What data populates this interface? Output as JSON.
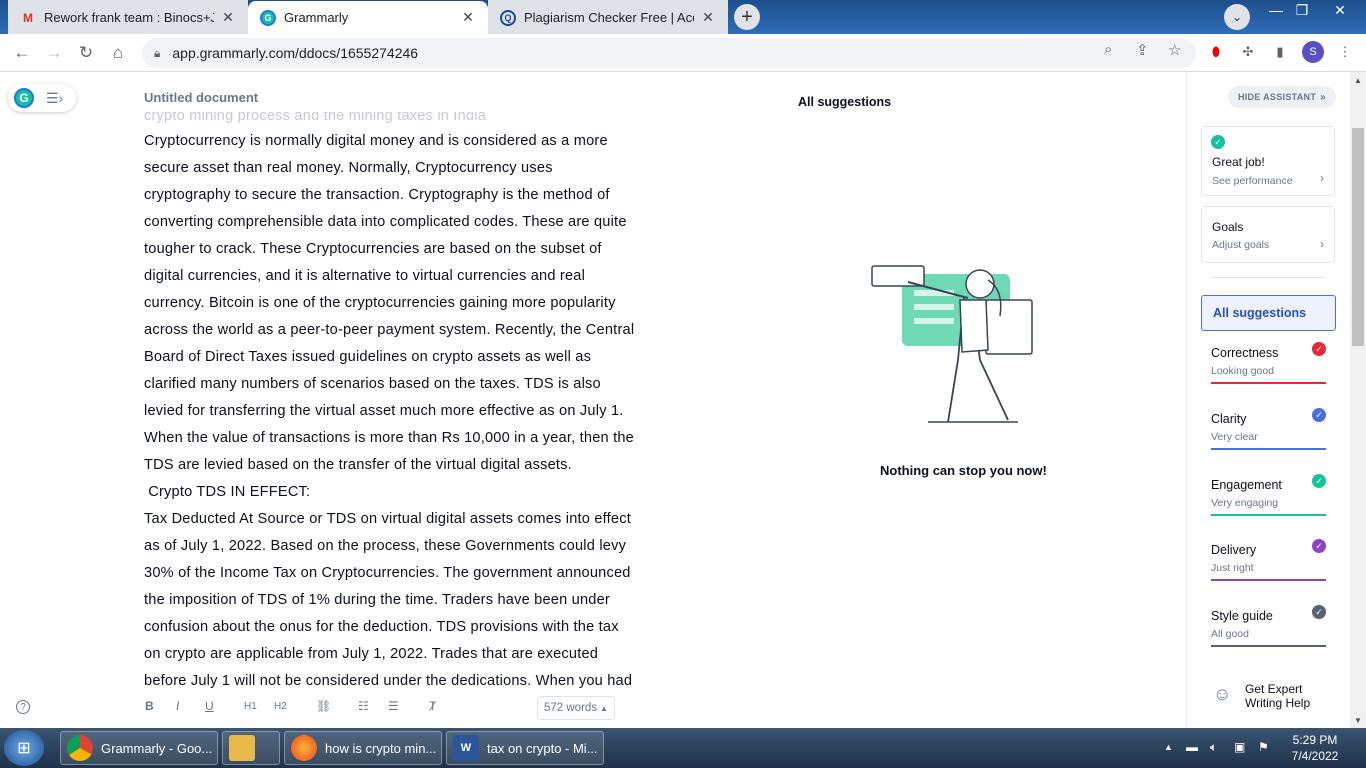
{
  "browser": {
    "tabs": [
      {
        "title": "Rework frank team : Binocs+June",
        "icon": "gmail-icon"
      },
      {
        "title": "Grammarly",
        "icon": "grammarly-icon"
      },
      {
        "title": "Plagiarism Checker Free | Accurat",
        "icon": "plagiarism-checker-icon"
      }
    ],
    "url": "app.grammarly.com/ddocs/1655274246",
    "profile_initial": "S"
  },
  "editor": {
    "doc_title": "Untitled document",
    "faded_line": "crypto mining process and the mining taxes in India",
    "lines": [
      "Cryptocurrency is normally digital money and is considered as a more",
      "secure asset than real money. Normally, Cryptocurrency uses",
      "cryptography to secure the transaction. Cryptography is the method of",
      "converting comprehensible data into complicated codes. These are quite",
      "tougher to crack. These Cryptocurrencies are based on the subset of",
      "digital currencies, and it is alternative to virtual currencies and real",
      "currency. Bitcoin is one of the cryptocurrencies gaining more popularity",
      "across the world as a peer-to-peer payment system. Recently, the Central",
      "Board of Direct Taxes issued guidelines on crypto assets as well as",
      "clarified many numbers of scenarios based on the taxes. TDS is also",
      "levied for transferring the virtual asset much more effective as on July 1.",
      "When the value of transactions is more than Rs 10,000 in a year, then the",
      "TDS are levied based on the transfer of the virtual digital assets.",
      " Crypto TDS IN EFFECT: ",
      "Tax Deducted At Source or TDS on virtual digital assets comes into effect",
      "as of July 1, 2022. Based on the process, these Governments could levy",
      "30% of the Income Tax on Cryptocurrencies. The government announced",
      "the imposition of TDS of 1% during the time. Traders have been under",
      "confusion about the onus for the deduction. TDS provisions with the tax",
      "on crypto are applicable from July 1, 2022. Trades that are executed",
      "before July 1 will not be considered under the dedications. When you had"
    ],
    "word_count": "572 words",
    "format_buttons": {
      "bold": "B",
      "italic": "I",
      "underline": "U",
      "h1": "H1",
      "h2": "H2"
    }
  },
  "suggestions": {
    "header": "All suggestions",
    "empty_message": "Nothing can stop you now!"
  },
  "assistant": {
    "hide_label": "HIDE ASSISTANT",
    "performance": {
      "title": "Great job!",
      "subtitle": "See performance"
    },
    "goals": {
      "title": "Goals",
      "subtitle": "Adjust goals"
    },
    "all_suggestions": "All suggestions",
    "categories": [
      {
        "name": "Correctness",
        "status": "Looking good",
        "color": "#e8263d"
      },
      {
        "name": "Clarity",
        "status": "Very clear",
        "color": "#4a6ee0"
      },
      {
        "name": "Engagement",
        "status": "Very engaging",
        "color": "#15c39a"
      },
      {
        "name": "Delivery",
        "status": "Just right",
        "color": "#8e44c7"
      },
      {
        "name": "Style guide",
        "status": "All good",
        "color": "#5a6173"
      }
    ],
    "expert_help": "Get Expert Writing Help"
  },
  "taskbar": {
    "items": [
      {
        "label": "Grammarly - Goo...",
        "icon": "chrome-icon"
      },
      {
        "label": "",
        "icon": "folder-icon"
      },
      {
        "label": "how is crypto min...",
        "icon": "firefox-icon"
      },
      {
        "label": "tax on crypto - Mi...",
        "icon": "word-icon"
      }
    ],
    "time": "5:29 PM",
    "date": "7/4/2022"
  }
}
